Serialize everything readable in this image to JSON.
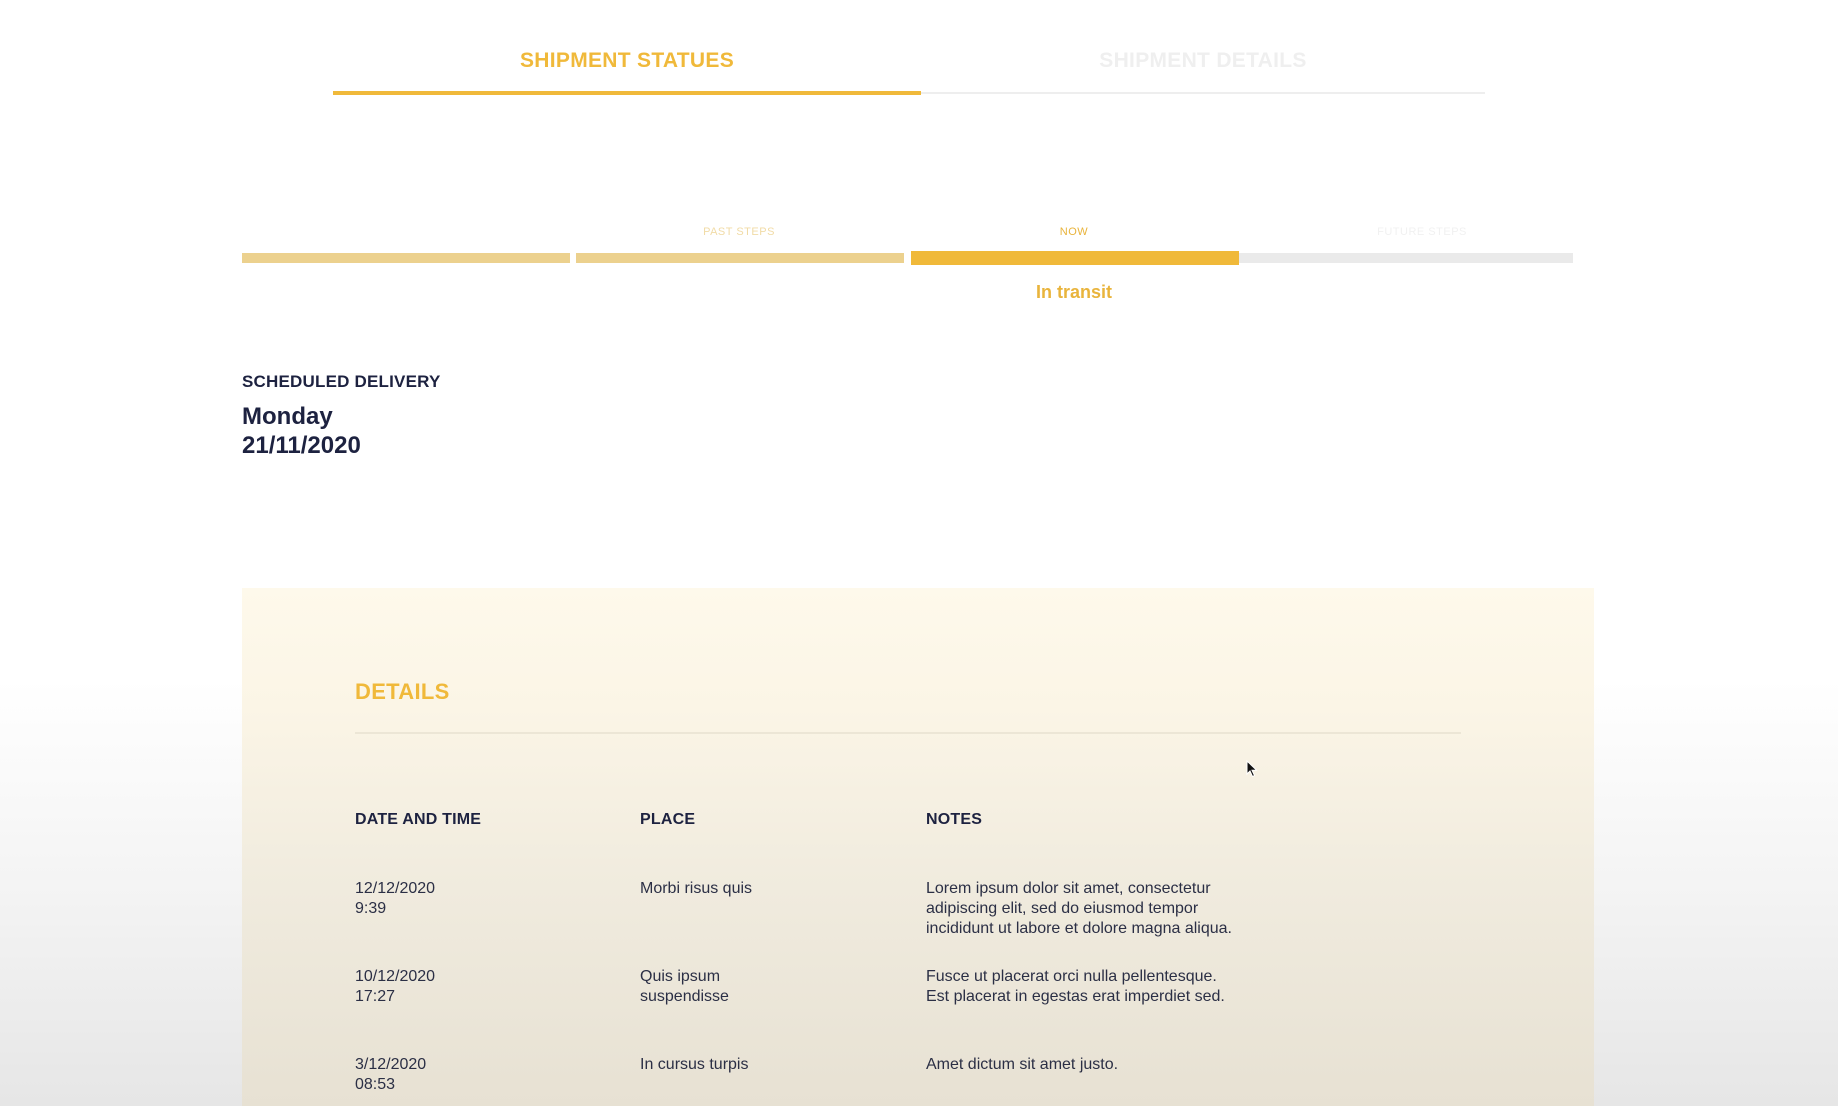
{
  "tabs": {
    "active": "SHIPMENT STATUES",
    "inactive": "SHIPMENT DETAILS"
  },
  "stepper": {
    "labels": {
      "past": "PAST STEPS",
      "now": "NOW",
      "future": "FUTURE STEPS"
    },
    "current_status": "In transit",
    "total_steps": 4,
    "completed_steps": 2,
    "current_step": 3,
    "colors": {
      "past": "#ecd18e",
      "now": "#f0b93a",
      "future": "#eaeaea"
    }
  },
  "scheduled": {
    "label": "SCHEDULED DELIVERY",
    "day": "Monday",
    "date": "21/11/2020"
  },
  "details": {
    "title": "DETAILS",
    "columns": {
      "datetime": "DATE AND TIME",
      "place": "PLACE",
      "notes": "NOTES"
    },
    "rows": [
      {
        "datetime": "12/12/2020\n9:39",
        "place": "Morbi  risus quis",
        "notes": "Lorem ipsum dolor sit amet, consectetur\nadipiscing elit, sed do eiusmod tempor\nincididunt ut labore et dolore magna aliqua."
      },
      {
        "datetime": "10/12/2020\n17:27",
        "place": "Quis ipsum\nsuspendisse",
        "notes": "Fusce ut placerat orci nulla pellentesque.\nEst placerat in egestas erat imperdiet sed."
      },
      {
        "datetime": "3/12/2020\n08:53",
        "place": "In cursus turpis",
        "notes": "Amet dictum sit amet justo."
      }
    ]
  },
  "colors": {
    "accent": "#f0b93a",
    "text_dark": "#1d2240",
    "panel_bg": "#fef9eb"
  },
  "icons": {
    "cursor": "mouse-pointer-icon"
  }
}
